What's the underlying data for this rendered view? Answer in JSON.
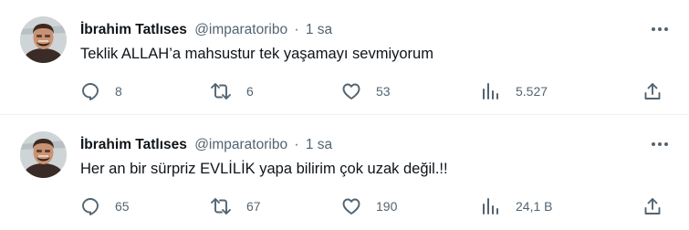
{
  "tweets": [
    {
      "author": "İbrahim Tatlıses",
      "handle": "@imparatoribo",
      "separator": "·",
      "time": "1 sa",
      "text": "Teklik ALLAH’a mahsustur tek yaşamayı sevmiyorum",
      "replies": "8",
      "retweets": "6",
      "likes": "53",
      "views": "5.527"
    },
    {
      "author": "İbrahim Tatlıses",
      "handle": "@imparatoribo",
      "separator": "·",
      "time": "1 sa",
      "text": "Her an bir sürpriz  EVLİLİK yapa bilirim çok uzak değil.!!",
      "replies": "65",
      "retweets": "67",
      "likes": "190",
      "views": "24,1 B"
    }
  ],
  "icons": {
    "more": "more-horizontal-icon",
    "reply": "reply-icon",
    "retweet": "retweet-icon",
    "like": "heart-icon",
    "views": "views-bar-chart-icon",
    "share": "share-icon"
  },
  "colors": {
    "text": "#0f1419",
    "secondary": "#536471",
    "divider": "#eff3f4"
  }
}
